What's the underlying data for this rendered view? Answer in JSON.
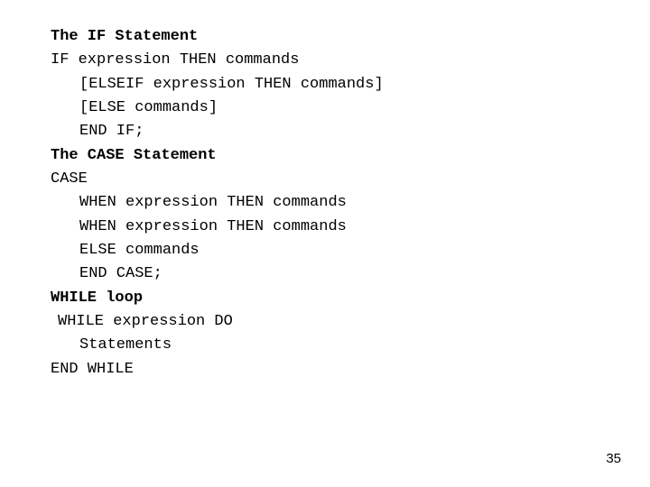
{
  "heading_if": "The IF Statement",
  "if_line": "IF expression THEN commands",
  "if_elseif": "[ELSEIF expression THEN commands]",
  "if_else": "[ELSE commands]",
  "if_end": "END IF;",
  "heading_case": "The CASE Statement",
  "case_line": "CASE",
  "case_when1": "WHEN expression THEN commands",
  "case_when2": "WHEN expression THEN commands",
  "case_else": "ELSE commands",
  "case_end": "END CASE;",
  "heading_while": "WHILE loop",
  "while_line": "WHILE expression DO",
  "while_body": "Statements",
  "while_end": "END WHILE",
  "page_number": "35"
}
